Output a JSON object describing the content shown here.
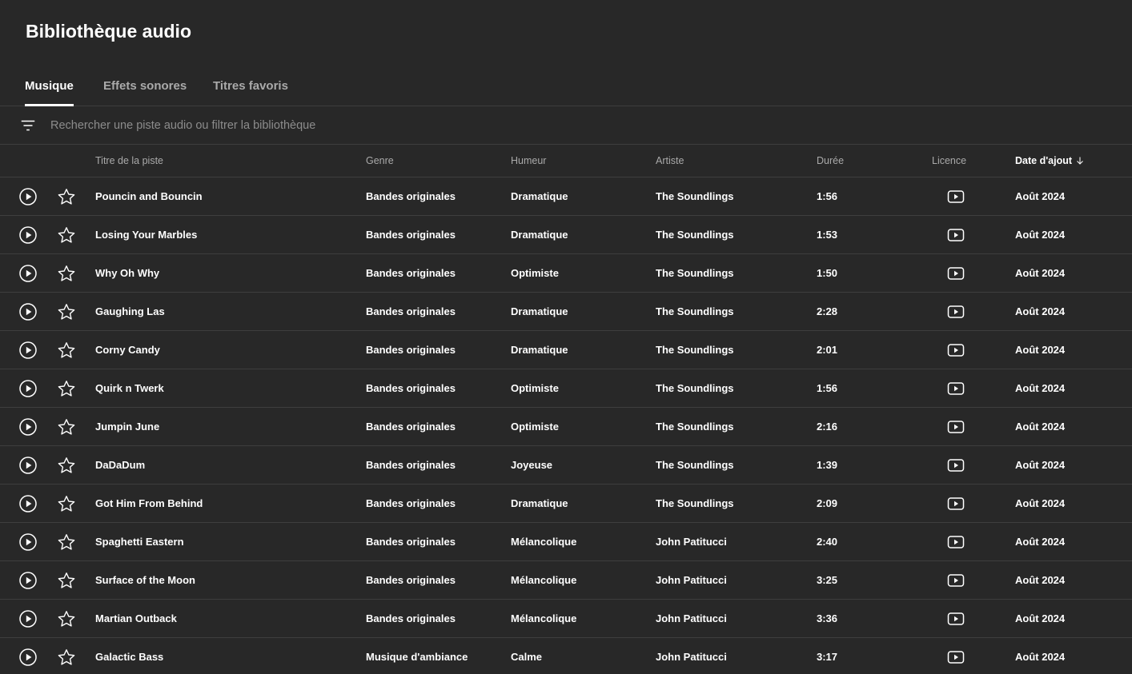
{
  "header": {
    "title": "Bibliothèque audio"
  },
  "tabs": [
    {
      "label": "Musique",
      "active": true
    },
    {
      "label": "Effets sonores",
      "active": false
    },
    {
      "label": "Titres favoris",
      "active": false
    }
  ],
  "search": {
    "placeholder": "Rechercher une piste audio ou filtrer la bibliothèque",
    "value": ""
  },
  "columns": {
    "title": "Titre de la piste",
    "genre": "Genre",
    "mood": "Humeur",
    "artist": "Artiste",
    "duration": "Durée",
    "license": "Licence",
    "date_added": "Date d'ajout"
  },
  "sort": {
    "column": "date_added",
    "direction": "descending",
    "icon": "arrow-down-icon"
  },
  "icons": {
    "filter": "filter-icon",
    "play": "play-circle-icon",
    "favorite": "star-outline-icon",
    "license": "youtube-license-icon"
  },
  "colors": {
    "background": "#282828",
    "text": "#ffffff",
    "muted": "#aaaaaa",
    "divider": "#3e3e3e"
  },
  "tracks": [
    {
      "title": "Pouncin and Bouncin",
      "genre": "Bandes originales",
      "mood": "Dramatique",
      "artist": "The Soundlings",
      "duration": "1:56",
      "date_added": "Août 2024"
    },
    {
      "title": "Losing Your Marbles",
      "genre": "Bandes originales",
      "mood": "Dramatique",
      "artist": "The Soundlings",
      "duration": "1:53",
      "date_added": "Août 2024"
    },
    {
      "title": "Why Oh Why",
      "genre": "Bandes originales",
      "mood": "Optimiste",
      "artist": "The Soundlings",
      "duration": "1:50",
      "date_added": "Août 2024"
    },
    {
      "title": "Gaughing Las",
      "genre": "Bandes originales",
      "mood": "Dramatique",
      "artist": "The Soundlings",
      "duration": "2:28",
      "date_added": "Août 2024"
    },
    {
      "title": "Corny Candy",
      "genre": "Bandes originales",
      "mood": "Dramatique",
      "artist": "The Soundlings",
      "duration": "2:01",
      "date_added": "Août 2024"
    },
    {
      "title": "Quirk n Twerk",
      "genre": "Bandes originales",
      "mood": "Optimiste",
      "artist": "The Soundlings",
      "duration": "1:56",
      "date_added": "Août 2024"
    },
    {
      "title": "Jumpin June",
      "genre": "Bandes originales",
      "mood": "Optimiste",
      "artist": "The Soundlings",
      "duration": "2:16",
      "date_added": "Août 2024"
    },
    {
      "title": "DaDaDum",
      "genre": "Bandes originales",
      "mood": "Joyeuse",
      "artist": "The Soundlings",
      "duration": "1:39",
      "date_added": "Août 2024"
    },
    {
      "title": "Got Him From Behind",
      "genre": "Bandes originales",
      "mood": "Dramatique",
      "artist": "The Soundlings",
      "duration": "2:09",
      "date_added": "Août 2024"
    },
    {
      "title": "Spaghetti Eastern",
      "genre": "Bandes originales",
      "mood": "Mélancolique",
      "artist": "John Patitucci",
      "duration": "2:40",
      "date_added": "Août 2024"
    },
    {
      "title": "Surface of the Moon",
      "genre": "Bandes originales",
      "mood": "Mélancolique",
      "artist": "John Patitucci",
      "duration": "3:25",
      "date_added": "Août 2024"
    },
    {
      "title": "Martian Outback",
      "genre": "Bandes originales",
      "mood": "Mélancolique",
      "artist": "John Patitucci",
      "duration": "3:36",
      "date_added": "Août 2024"
    },
    {
      "title": "Galactic Bass",
      "genre": "Musique d'ambiance",
      "mood": "Calme",
      "artist": "John Patitucci",
      "duration": "3:17",
      "date_added": "Août 2024"
    }
  ]
}
